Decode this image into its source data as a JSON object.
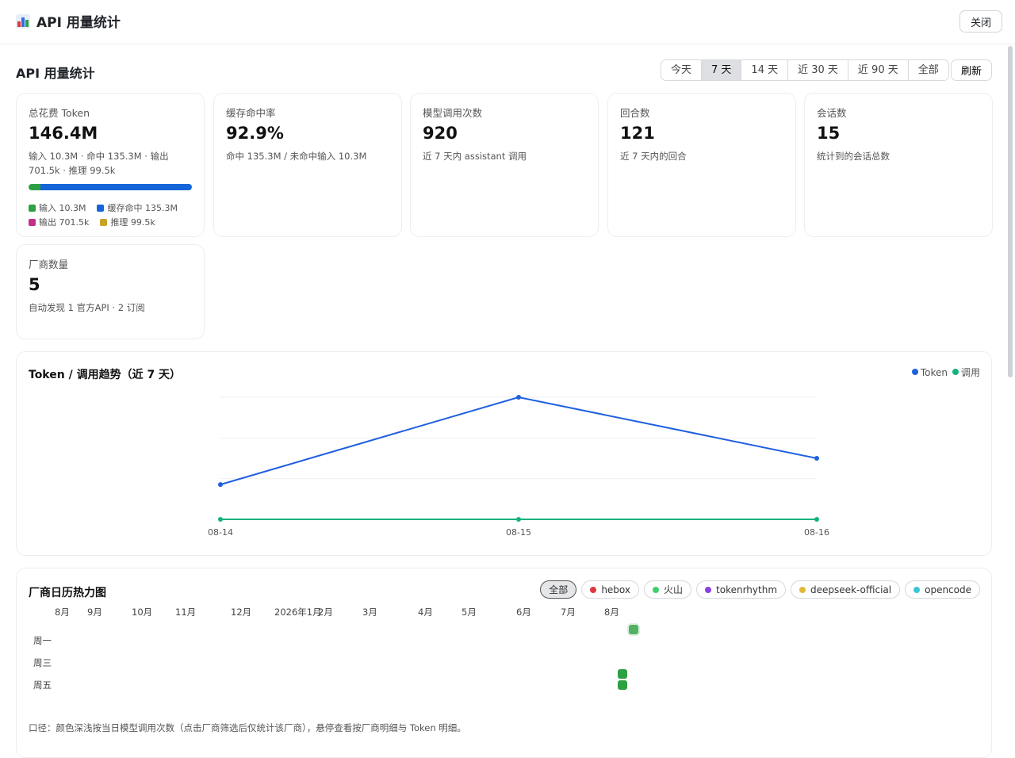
{
  "modal": {
    "title": "API 用量统计",
    "close_label": "关闭"
  },
  "header": {
    "title": "API 用量统计",
    "refresh_label": "刷新"
  },
  "range_tabs": [
    {
      "label": "今天",
      "active": false
    },
    {
      "label": "7 天",
      "active": true
    },
    {
      "label": "14 天",
      "active": false
    },
    {
      "label": "近 30 天",
      "active": false
    },
    {
      "label": "近 90 天",
      "active": false
    },
    {
      "label": "全部",
      "active": false
    }
  ],
  "stats": {
    "total_tokens": {
      "label": "总花费 Token",
      "value": "146.4M",
      "sub": "输入 10.3M · 命中 135.3M · 输出 701.5k · 推理 99.5k"
    },
    "token_breakdown": {
      "input": {
        "label": "输入 10.3M",
        "share": 0.0704,
        "color": "#2ea043"
      },
      "cache_hit": {
        "label": "缓存命中 135.3M",
        "share": 0.9241,
        "color": "#1565d8"
      },
      "output": {
        "label": "输出 701.5k",
        "share": 0.0048,
        "color": "#c2308a"
      },
      "reasoning": {
        "label": "推理 99.5k",
        "share": 0.0007,
        "color": "#c9a227"
      }
    },
    "cache_rate": {
      "label": "缓存命中率",
      "value": "92.9%",
      "sub": "命中 135.3M / 未命中输入 10.3M"
    },
    "model_calls": {
      "label": "模型调用次数",
      "value": "920",
      "sub": "近 7 天内 assistant 调用"
    },
    "rounds": {
      "label": "回合数",
      "value": "121",
      "sub": "近 7 天内的回合"
    },
    "sessions": {
      "label": "会话数",
      "value": "15",
      "sub": "统计到的会话总数"
    },
    "vendors": {
      "label": "厂商数量",
      "value": "5",
      "sub": "自动发现 1 官方API · 2 订阅"
    }
  },
  "trend": {
    "title": "Token / 调用趋势（近 7 天）",
    "legend": [
      {
        "label": "Token",
        "color": "#1f5fe0"
      },
      {
        "label": "调用",
        "color": "#14b37d"
      }
    ]
  },
  "chart_data": {
    "type": "line",
    "title": "Token / 调用趋势（近 7 天）",
    "categories": [
      "08-14",
      "08-15",
      "08-16"
    ],
    "series": [
      {
        "name": "Token",
        "values": [
          0.285,
          1.0,
          0.5
        ],
        "color": "#1f5fe0"
      },
      {
        "name": "调用",
        "values": [
          0,
          0,
          0
        ],
        "color": "#14b37d"
      }
    ],
    "ylim": [
      0,
      1
    ],
    "grid": true,
    "legend_position": "top-right"
  },
  "heatmap": {
    "title": "厂商日历热力图",
    "chips": [
      {
        "label": "全部",
        "active": true,
        "color": ""
      },
      {
        "label": "hebox",
        "active": false,
        "color": "#e0383e"
      },
      {
        "label": "火山",
        "active": false,
        "color": "#3dd06a"
      },
      {
        "label": "tokenrhythm",
        "active": false,
        "color": "#8a3fe0"
      },
      {
        "label": "deepseek-official",
        "active": false,
        "color": "#e0b93a"
      },
      {
        "label": "opencode",
        "active": false,
        "color": "#38c6d6"
      }
    ],
    "months": [
      "8月",
      "9月",
      "10月",
      "11月",
      "12月",
      "2026年1月",
      "2月",
      "3月",
      "4月",
      "5月",
      "6月",
      "7月",
      "8月"
    ],
    "weekdays": [
      "周一",
      "周三",
      "周五"
    ],
    "active_days": [
      {
        "week": 53,
        "weekday": 0,
        "level": 0.6
      },
      {
        "week": 52,
        "weekday": 4,
        "level": 1
      },
      {
        "week": 52,
        "weekday": 5,
        "level": 1
      }
    ],
    "footnote": "口径：颜色深浅按当日模型调用次数（点击厂商筛选后仅统计该厂商），悬停查看按厂商明细与 Token 明细。"
  }
}
